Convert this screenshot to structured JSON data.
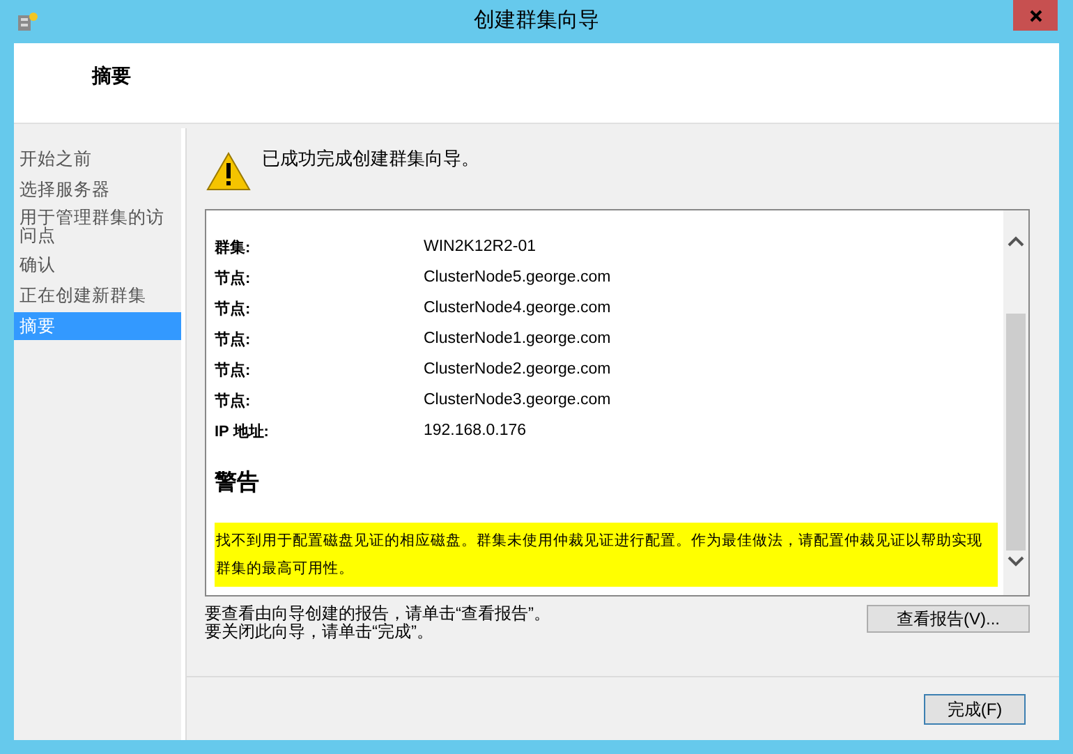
{
  "window": {
    "title": "创建群集向导"
  },
  "header": {
    "title": "摘要"
  },
  "sidebar": {
    "items": [
      {
        "label": "开始之前",
        "selected": false
      },
      {
        "label": "选择服务器",
        "selected": false
      },
      {
        "label": "用于管理群集的访问点",
        "selected": false
      },
      {
        "label": "确认",
        "selected": false
      },
      {
        "label": "正在创建新群集",
        "selected": false
      },
      {
        "label": "摘要",
        "selected": true
      }
    ]
  },
  "status_message": "已成功完成创建群集向导。",
  "report": {
    "rows": [
      {
        "label": "群集:",
        "value": "WIN2K12R2-01"
      },
      {
        "label": "节点:",
        "value": "ClusterNode5.george.com"
      },
      {
        "label": "节点:",
        "value": "ClusterNode4.george.com"
      },
      {
        "label": "节点:",
        "value": "ClusterNode1.george.com"
      },
      {
        "label": "节点:",
        "value": "ClusterNode2.george.com"
      },
      {
        "label": "节点:",
        "value": "ClusterNode3.george.com"
      },
      {
        "label": "IP 地址:",
        "value": "192.168.0.176"
      }
    ],
    "warning_title": "警告",
    "warning_text": "找不到用于配置磁盘见证的相应磁盘。群集未使用仲裁见证进行配置。作为最佳做法，请配置仲裁见证以帮助实现群集的最高可用性。"
  },
  "instructions": [
    "要查看由向导创建的报告，请单击“查看报告”。",
    "要关闭此向导，请单击“完成”。"
  ],
  "view_report_button": "查看报告(V)...",
  "finish_button": "完成(F)"
}
